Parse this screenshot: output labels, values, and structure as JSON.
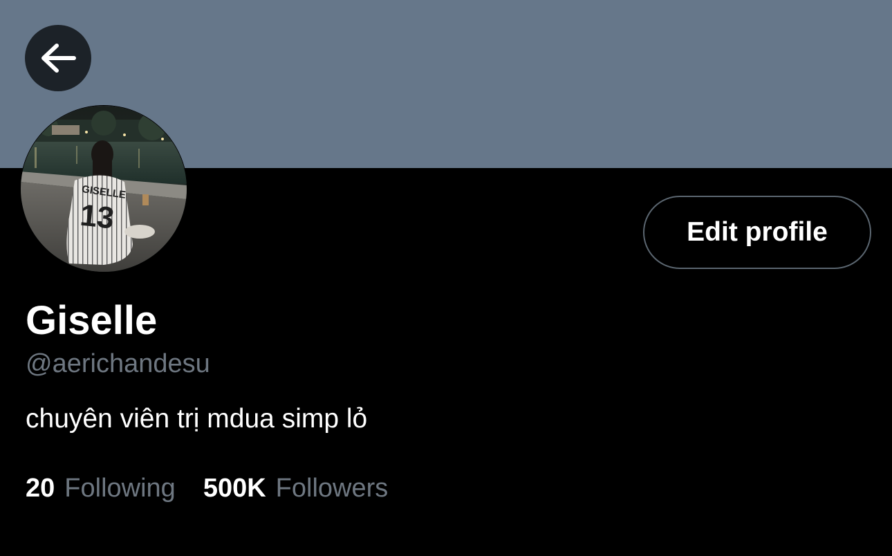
{
  "header": {
    "banner_color": "#66778a",
    "back_icon": "arrow-left-icon"
  },
  "profile": {
    "display_name": "Giselle",
    "handle": "@aerichandesu",
    "bio": "chuyên viên trị mdua simp lỏ",
    "avatar_jersey_name": "GISELLE",
    "avatar_jersey_number": "13",
    "edit_button_label": "Edit profile"
  },
  "stats": {
    "following_count": "20",
    "following_label": "Following",
    "followers_count": "500K",
    "followers_label": "Followers"
  },
  "colors": {
    "background": "#000000",
    "text_primary": "#ffffff",
    "text_secondary": "#6e7781",
    "button_border": "#5b6670"
  }
}
